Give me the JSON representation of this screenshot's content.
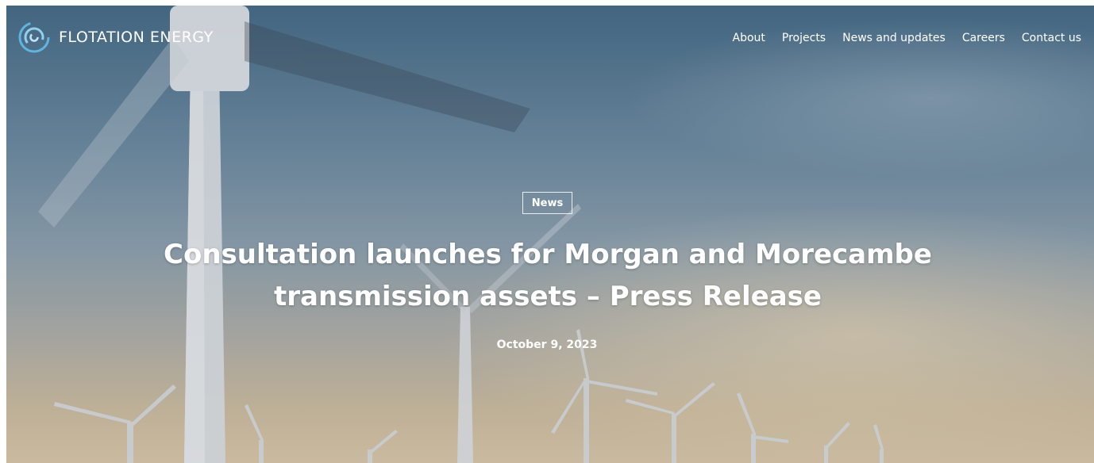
{
  "brand": {
    "name": "FLOTATION ENERGY",
    "logo_icon": "swirl-logo-icon"
  },
  "nav": {
    "items": [
      {
        "label": "About"
      },
      {
        "label": "Projects"
      },
      {
        "label": "News and updates"
      },
      {
        "label": "Careers"
      },
      {
        "label": "Contact us"
      }
    ]
  },
  "hero": {
    "category": "News",
    "title": "Consultation launches for Morgan and Morecambe transmission assets – Press Release",
    "date": "October 9, 2023"
  }
}
